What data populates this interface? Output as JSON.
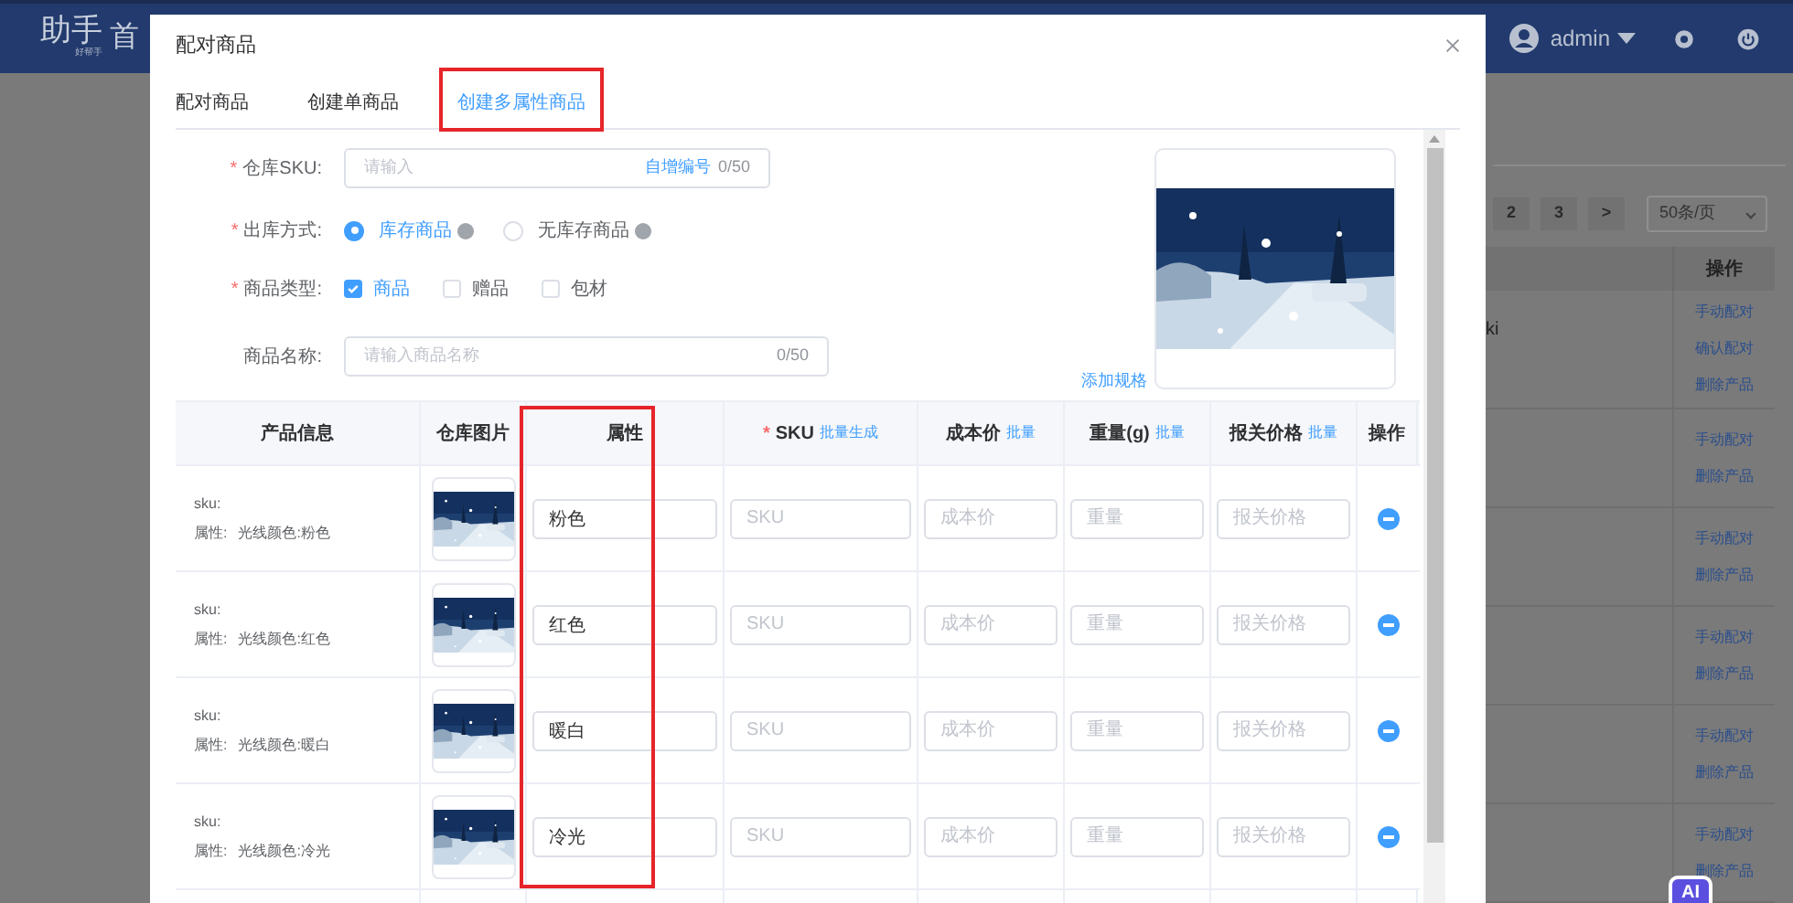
{
  "app": {
    "logo": "助手",
    "logo_sub": "好帮手",
    "nav": "首",
    "user": "admin",
    "pages": [
      {
        "label": "2"
      },
      {
        "label": "3"
      },
      {
        "label": ">"
      }
    ],
    "page_size": "50条/页",
    "column_header": "操作",
    "cell_fragment": "ki",
    "action_groups": [
      [
        "手动配对",
        "确认配对",
        "删除产品"
      ],
      [
        "手动配对",
        "删除产品"
      ],
      [
        "手动配对",
        "删除产品"
      ],
      [
        "手动配对",
        "删除产品"
      ],
      [
        "手动配对",
        "删除产品"
      ],
      [
        "手动配对",
        "删除产品"
      ]
    ],
    "ai_badge": "AI"
  },
  "dialog": {
    "title": "配对商品",
    "tabs": [
      {
        "label": "配对商品",
        "selected": false,
        "highlighted": false
      },
      {
        "label": "创建单商品",
        "selected": false,
        "highlighted": false
      },
      {
        "label": "创建多属性商品",
        "selected": true,
        "highlighted": true
      }
    ],
    "sku_field": {
      "mark": "*",
      "label": "仓库SKU:",
      "placeholder": "请输入",
      "link": "自增编号",
      "counter": "0/50"
    },
    "outbound": {
      "mark": "*",
      "label": "出库方式:",
      "options": [
        {
          "label": "库存商品",
          "selected": true
        },
        {
          "label": "无库存商品",
          "selected": false
        }
      ]
    },
    "product_type": {
      "mark": "*",
      "label": "商品类型:",
      "options": [
        {
          "label": "商品",
          "checked": true
        },
        {
          "label": "赠品",
          "checked": false
        },
        {
          "label": "包材",
          "checked": false
        }
      ]
    },
    "name_field": {
      "label": "商品名称:",
      "placeholder": "请输入商品名称",
      "counter": "0/50"
    },
    "add_spec": "添加规格",
    "table": {
      "columns": [
        {
          "label": "产品信息",
          "highlighted": false
        },
        {
          "label": "仓库图片",
          "highlighted": false
        },
        {
          "label": "属性",
          "highlighted": true
        },
        {
          "label": "SKU",
          "mark": "*",
          "action": "批量生成",
          "highlighted": false
        },
        {
          "label": "成本价",
          "action": "批量",
          "highlighted": false
        },
        {
          "label": "重量(g)",
          "action": "批量",
          "highlighted": false
        },
        {
          "label": "报关价格",
          "action": "批量",
          "highlighted": false
        },
        {
          "label": "操作",
          "highlighted": false
        }
      ],
      "rows": [
        {
          "sku_label": "sku:",
          "attr_label": "属性:",
          "attr_value": "光线颜色:粉色",
          "attribute": "粉色",
          "sku_placeholder": "SKU",
          "cost_placeholder": "成本价",
          "weight_placeholder": "重量",
          "price_placeholder": "报关价格"
        },
        {
          "sku_label": "sku:",
          "attr_label": "属性:",
          "attr_value": "光线颜色:红色",
          "attribute": "红色",
          "sku_placeholder": "SKU",
          "cost_placeholder": "成本价",
          "weight_placeholder": "重量",
          "price_placeholder": "报关价格"
        },
        {
          "sku_label": "sku:",
          "attr_label": "属性:",
          "attr_value": "光线颜色:暖白",
          "attribute": "暖白",
          "sku_placeholder": "SKU",
          "cost_placeholder": "成本价",
          "weight_placeholder": "重量",
          "price_placeholder": "报关价格"
        },
        {
          "sku_label": "sku:",
          "attr_label": "属性:",
          "attr_value": "光线颜色:冷光",
          "attribute": "冷光",
          "sku_placeholder": "SKU",
          "cost_placeholder": "成本价",
          "weight_placeholder": "重量",
          "price_placeholder": "报关价格"
        }
      ]
    }
  }
}
